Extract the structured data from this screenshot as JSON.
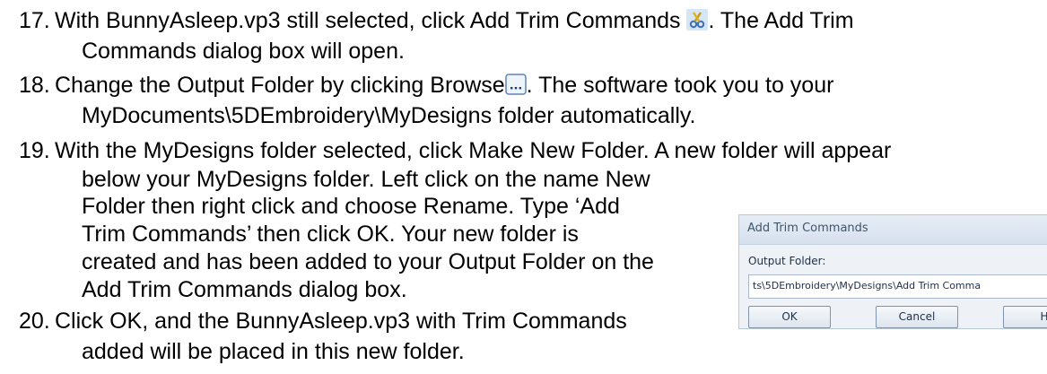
{
  "steps": [
    {
      "number": "17.",
      "line1_before_icon": "With BunnyAsleep.vp3 still selected, click Add Trim Commands",
      "line1_after_icon": ". The Add Trim",
      "line2": "Commands dialog box will open."
    },
    {
      "number": "18.",
      "line1_before_icon": "Change the Output Folder by clicking Browse",
      "line1_after_icon": ". The software took you to your",
      "line2": "MyDocuments\\5DEmbroidery\\MyDesigns folder automatically."
    },
    {
      "number": "19.",
      "lines": [
        "With the MyDesigns folder selected, click Make New Folder. A new folder will appear",
        "below your MyDesigns folder. Left click on the name New",
        "Folder then right click and choose Rename. Type ‘Add",
        "Trim Commands’ then click OK. Your new folder is",
        "created and has been added to your Output Folder on the",
        "Add Trim Commands dialog box."
      ]
    },
    {
      "number": "20.",
      "lines": [
        "Click OK, and the BunnyAsleep.vp3 with Trim Commands",
        "added will be placed in this new folder."
      ]
    }
  ],
  "icons": {
    "trim": "scissors-icon",
    "browse": "ellipsis-browse-icon"
  },
  "dialog": {
    "title": "Add Trim Commands",
    "output_label": "Output Folder:",
    "output_value": "ts\\5DEmbroidery\\MyDesigns\\Add Trim Comma",
    "ok_label": "OK",
    "cancel_label": "Cancel",
    "help_label": "H"
  }
}
